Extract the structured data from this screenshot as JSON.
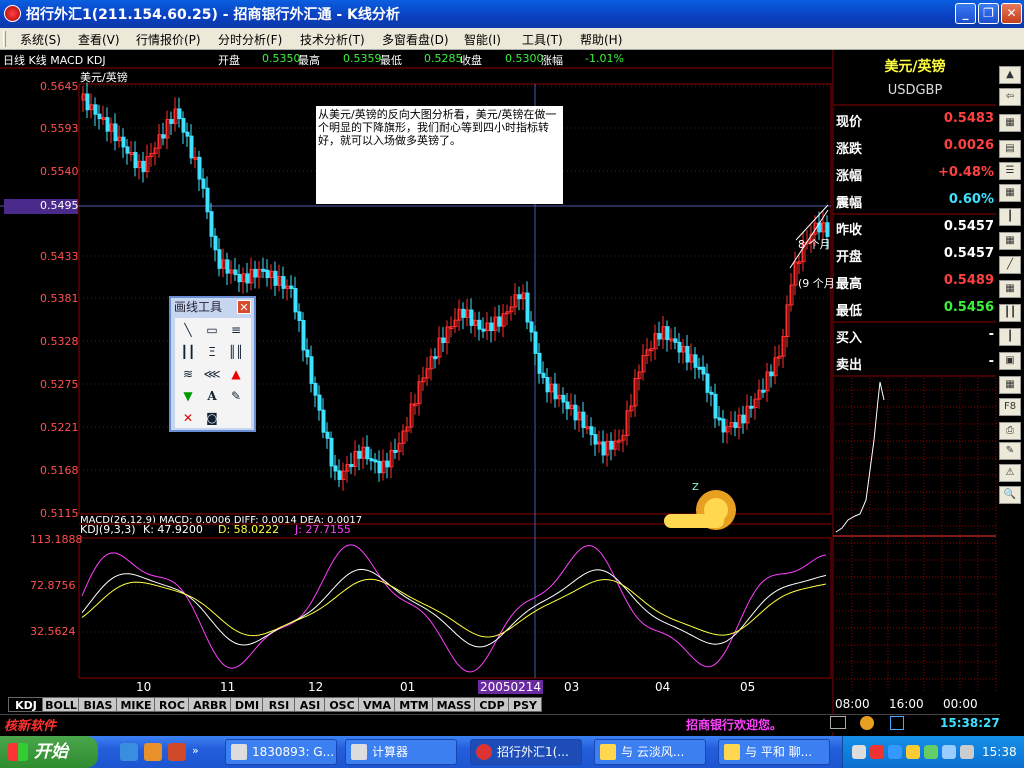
{
  "window": {
    "title": "招行外汇1(211.154.60.25) - 招商银行外汇通 - K线分析",
    "minimize": "_",
    "maximize": "❐",
    "close": "✕"
  },
  "menu": [
    "系统(S)",
    "查看(V)",
    "行情报价(P)",
    "分时分析(F)",
    "技术分析(T)",
    "多窗看盘(D)",
    "智能(I)",
    "工具(T)",
    "帮助(H)"
  ],
  "chart_header": {
    "mode": "日线 K线 MACD KDJ",
    "open_label": "开盘",
    "open": "0.5350",
    "high_label": "最高",
    "high": "0.5359",
    "low_label": "最低",
    "low": "0.5285",
    "close_label": "收盘",
    "close": "0.5300",
    "change_label": "涨幅",
    "change": "-1.01%"
  },
  "symbol_tag": "美元/英镑",
  "note": "从美元/英镑的反向大图分析看，美元/英镑在做一个明显的下降旗形，我们耐心等到四小时指标转好，就可以入场做多英镑了。",
  "cursor_price": "0.5495",
  "price_ticks": [
    "0.5645",
    "0.5593",
    "0.5540",
    "0.5433",
    "0.5381",
    "0.5328",
    "0.5275",
    "0.5221",
    "0.5168",
    "0.5115"
  ],
  "macd_line": "MACD(26,12,9) MACD: 0.0006 DIFF: 0.0014 DEA: 0.0017",
  "kdj": {
    "name": "KDJ(9,3,3)",
    "k": "K: 47.9200",
    "d": "D: 58.0222",
    "j": "J: 27.7155",
    "ticks": [
      "113.1888",
      "72.8756",
      "32.5624"
    ]
  },
  "x_labels": [
    "10",
    "11",
    "12",
    "01",
    "03",
    "04",
    "05"
  ],
  "cursor_date": "20050214",
  "annotations": [
    "8 个月",
    "(9 个月"
  ],
  "toolbox": {
    "title": "画线工具",
    "close": "✕"
  },
  "quote": {
    "title": "美元/英镑",
    "code": "USDGBP",
    "rows": [
      {
        "label": "现价",
        "value": "0.5483",
        "color": "#ff4040"
      },
      {
        "label": "涨跌",
        "value": "0.0026",
        "color": "#ff4040"
      },
      {
        "label": "涨幅",
        "value": "+0.48%",
        "color": "#ff4040"
      },
      {
        "label": "震幅",
        "value": "0.60%",
        "color": "#40e0ff"
      },
      {
        "label": "昨收",
        "value": "0.5457",
        "color": "#ffffff"
      },
      {
        "label": "开盘",
        "value": "0.5457",
        "color": "#ffffff"
      },
      {
        "label": "最高",
        "value": "0.5489",
        "color": "#ff4040"
      },
      {
        "label": "最低",
        "value": "0.5456",
        "color": "#3cf03c"
      },
      {
        "label": "买入",
        "value": "-",
        "color": "#ffffff"
      },
      {
        "label": "卖出",
        "value": "-",
        "color": "#ffffff"
      }
    ],
    "time_labels": [
      "08:00",
      "16:00",
      "00:00"
    ]
  },
  "tabs": [
    "KDJ",
    "BOLL",
    "BIAS",
    "MIKE",
    "ROC",
    "ARBR",
    "DMI",
    "RSI",
    "ASI",
    "OSC",
    "VMA",
    "MTM",
    "MASS",
    "CDP",
    "PSY"
  ],
  "status": {
    "logo": "核新软件",
    "welcome": "招商银行欢迎您。",
    "clock": "15:38:27"
  },
  "taskbar": {
    "start": "开始",
    "tasks": [
      "1830893: G...",
      "计算器",
      "招行外汇1(...",
      "与 云淡风...",
      "与 平和 聊..."
    ],
    "clock": "15:38"
  },
  "colors": {
    "up": "#ff3030",
    "down": "#40e0ff",
    "k_line": "#ffffff",
    "d_line": "#ffff40",
    "j_line": "#ff40ff",
    "grid": "#8a0000"
  }
}
